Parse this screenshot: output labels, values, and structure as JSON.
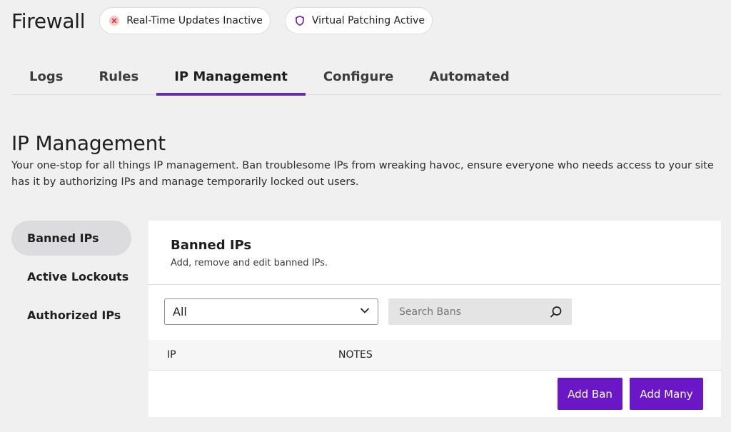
{
  "header": {
    "title": "Firewall",
    "badges": [
      {
        "label": "Real-Time Updates Inactive",
        "icon": "x-circle-icon",
        "color": "#d63638"
      },
      {
        "label": "Virtual Patching Active",
        "icon": "shield-icon",
        "color": "#6a17c8"
      }
    ]
  },
  "tabs": [
    {
      "label": "Logs"
    },
    {
      "label": "Rules"
    },
    {
      "label": "IP Management",
      "active": true
    },
    {
      "label": "Configure"
    },
    {
      "label": "Automated"
    }
  ],
  "page": {
    "heading": "IP Management",
    "description": "Your one-stop for all things IP management. Ban troublesome IPs from wreaking havoc, ensure everyone who needs access to your site has it by authorizing IPs and manage temporarily locked out users."
  },
  "sidebar": {
    "items": [
      {
        "label": "Banned IPs",
        "active": true
      },
      {
        "label": "Active Lockouts"
      },
      {
        "label": "Authorized IPs"
      }
    ]
  },
  "panel": {
    "title": "Banned IPs",
    "subtitle": "Add, remove and edit banned IPs.",
    "filter": {
      "selected": "All"
    },
    "search": {
      "placeholder": "Search Bans",
      "value": ""
    },
    "table": {
      "columns": [
        "IP",
        "NOTES"
      ]
    },
    "buttons": {
      "add_ban": "Add Ban",
      "add_many": "Add Many"
    }
  },
  "colors": {
    "accent": "#6a17c8",
    "tab_underline": "#5f2ea9",
    "error": "#d63638"
  }
}
